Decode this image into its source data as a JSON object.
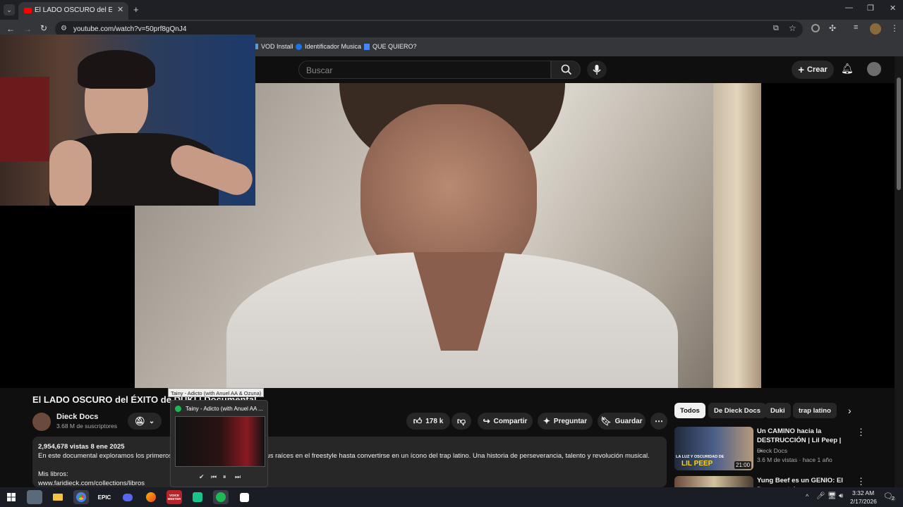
{
  "browser": {
    "tab_title": "El LADO OSCURO del ÉXITO de",
    "url": "youtube.com/watch?v=50prf8gQnJ4",
    "bookmarks": [
      "VOD Install",
      "Identificador Musica",
      "QUE QUIERO?"
    ]
  },
  "youtube": {
    "search_placeholder": "Buscar",
    "create_label": "Crear",
    "video_title": "El LADO OSCURO del ÉXITO de DUKI | Documental",
    "channel_name": "Dieck Docs",
    "subscribers": "3.68 M de suscriptores",
    "likes": "178 k",
    "share_label": "Compartir",
    "ask_label": "Preguntar",
    "save_label": "Guardar",
    "views_date": "2,954,678 vistas  8 ene 2025",
    "desc_line1": "En este documental exploramos los primeros",
    "desc_line1b": "e sus raíces en el freestyle hasta convertirse en un ícono del trap latino. Una historia de perseverancia, talento y revolución musical.",
    "desc_line2": "Mis libros:",
    "desc_line3": "www.faridieck.com/collections/libros",
    "chips": [
      "Todos",
      "De Dieck Docs",
      "Duki",
      "trap latino"
    ],
    "recs": [
      {
        "title": "Un CAMINO hacia la DESTRUCCIÓN | Lil Peep | ...",
        "channel": "Dieck Docs",
        "meta": "3.6 M de vistas · hace 1 año",
        "duration": "21:00",
        "thumb_text": "LA LUZ Y OSCURIDAD DE",
        "thumb_name": "LIL PEEP"
      },
      {
        "title": "Yung Beef es un GENIO: El Documental",
        "channel": "",
        "meta": "",
        "duration": "",
        "thumb_text": "",
        "thumb_name": ""
      }
    ]
  },
  "spotify": {
    "tooltip": "Tainy - Adicto (with Anuel AA & Ozuna)",
    "title": "Tainy - Adicto (with Anuel AA ..."
  },
  "taskbar": {
    "time": "3:32 AM",
    "date": "2/17/2026",
    "notifications": "2",
    "epic_label": "EPIC",
    "voicemeeter_label": "VOICE MEETER"
  },
  "colors": {
    "accent_red": "#ff0000",
    "spotify_green": "#1db954",
    "chrome_bg": "#35363a"
  }
}
